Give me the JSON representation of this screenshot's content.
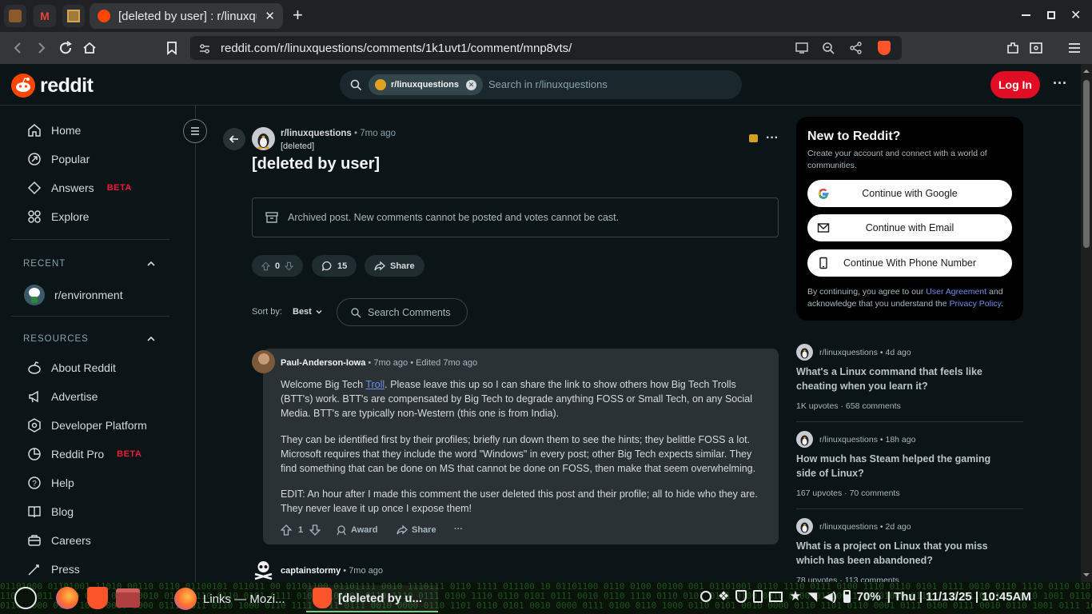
{
  "browser": {
    "tab_title": "[deleted by user] : r/linuxquestions",
    "url": "reddit.com/r/linuxquestions/comments/1k1uvt1/comment/mnp8vts/",
    "new_tab": "+"
  },
  "header": {
    "logo": "reddit",
    "search_chip": "r/linuxquestions",
    "search_placeholder": "Search in r/linuxquestions",
    "login": "Log In"
  },
  "sidebar": {
    "nav": [
      {
        "label": "Home",
        "icon": "home-icon"
      },
      {
        "label": "Popular",
        "icon": "popular-icon"
      },
      {
        "label": "Answers",
        "icon": "answers-icon",
        "badge": "BETA"
      },
      {
        "label": "Explore",
        "icon": "explore-icon"
      }
    ],
    "recent_heading": "RECENT",
    "recent": [
      {
        "label": "r/environment"
      }
    ],
    "resources_heading": "RESOURCES",
    "resources": [
      {
        "label": "About Reddit",
        "icon": "about-icon"
      },
      {
        "label": "Advertise",
        "icon": "megaphone-icon"
      },
      {
        "label": "Developer Platform",
        "icon": "developer-icon"
      },
      {
        "label": "Reddit Pro",
        "icon": "pro-icon",
        "badge": "BETA"
      },
      {
        "label": "Help",
        "icon": "help-icon"
      },
      {
        "label": "Blog",
        "icon": "blog-icon"
      },
      {
        "label": "Careers",
        "icon": "careers-icon"
      },
      {
        "label": "Press",
        "icon": "press-icon"
      }
    ]
  },
  "post": {
    "subreddit": "r/linuxquestions",
    "time": "7mo ago",
    "author": "[deleted]",
    "title": "[deleted by user]",
    "archived_notice": "Archived post. New comments cannot be posted and votes cannot be cast.",
    "votes": "0",
    "comments": "15",
    "share": "Share",
    "sort_label": "Sort by:",
    "sort_value": "Best",
    "search_comments_placeholder": "Search Comments"
  },
  "comment": {
    "author": "Paul-Anderson-Iowa",
    "meta": "7mo ago • Edited 7mo ago",
    "p1_pre": "Welcome Big Tech ",
    "p1_link": "Troll",
    "p1_post": ". Please leave this up so I can share the link to show others how Big Tech Trolls (BTT's) work. BTT's are compensated by Big Tech to degrade anything FOSS or Small Tech, on any Social Media. BTT's are typically non-Western (this one is from India).",
    "p2": "They can be identified first by their profiles; briefly run down them to see the hints; they belittle FOSS a lot. Microsoft requires that they include the word \"Windows\" in every post; other Big Tech expects similar. They find something that can be done on MS that cannot be done on FOSS, then make that seem overwhelming.",
    "p3": "EDIT: An hour after I made this comment the user deleted this post and their profile; all to hide who they are. They never leave it up once I expose them!",
    "votes": "1",
    "award": "Award",
    "share": "Share",
    "more": "···"
  },
  "comment2": {
    "author": "captainstormy",
    "meta": "7mo ago"
  },
  "new_to_reddit": {
    "title": "New to Reddit?",
    "subtitle": "Create your account and connect with a world of communities.",
    "google": "Continue with Google",
    "email": "Continue with Email",
    "phone": "Continue With Phone Number",
    "legal_pre": "By continuing, you agree to our ",
    "legal_link1": "User Agreement",
    "legal_mid": " and acknowledge that you understand the ",
    "legal_link2": "Privacy Policy",
    "legal_post": "."
  },
  "related": [
    {
      "sub": "r/linuxquestions",
      "time": "4d ago",
      "title": "What's a Linux command that feels like cheating when you learn it?",
      "upvotes": "1K upvotes",
      "comments": "658 comments"
    },
    {
      "sub": "r/linuxquestions",
      "time": "18h ago",
      "title": "How much has Steam helped the gaming side of Linux?",
      "upvotes": "167 upvotes",
      "comments": "70 comments"
    },
    {
      "sub": "r/linuxquestions",
      "time": "2d ago",
      "title": "What is a project on Linux that you miss which has been abandoned?",
      "upvotes": "78 upvotes",
      "comments": "113 comments"
    }
  ],
  "taskbar": {
    "app1": "Links — Mozi...",
    "app2": "[deleted by u...",
    "battery": "70%",
    "clock": "| Thu | 11/13/25 | 10:45AM"
  },
  "colors": {
    "accent": "#e00d24",
    "brand": "#ff4500",
    "link": "#6f8fe8"
  }
}
